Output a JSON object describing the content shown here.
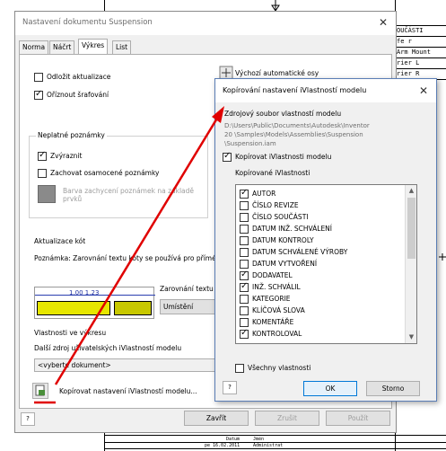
{
  "background_drawing": {
    "title_block_labels": [
      "OUČÁSTI",
      "fe r",
      "Arm Mount",
      "rier L",
      "rier R"
    ],
    "bottom_row": [
      "Datum",
      "Jmén",
      "pe 16.02.2011",
      "Administrat"
    ]
  },
  "main_dialog": {
    "title": "Nastavení dokumentu Suspension",
    "close_label": "✕",
    "tabs": [
      "Norma",
      "Náčrt",
      "Výkres",
      "List"
    ],
    "postpone_update": "Odložit aktualizace",
    "clip_hatching": "Oříznout šrafování",
    "default_axes": "Výchozí automatické osy",
    "invalid_notes": {
      "title": "Neplatné poznámky",
      "highlight": "Zvýraznit",
      "keep_orphaned": "Zachovat osamocené poznámky",
      "capture_color": "Barva zachycení poznámek na základě prvků"
    },
    "dimension_update": {
      "title": "Aktualizace kót",
      "note_text": "Poznámka: Zarovnání textu kóty se používá pro přímé",
      "preview_dim_text": "1.00 1.23",
      "text_alignment_label": "Zarovnání textu",
      "placement_button": "Umístění pohled"
    },
    "properties_in_drawing": {
      "title": "Vlastnosti ve výkresu",
      "source_label": "Další zdroj uživatelských iVlastností modelu",
      "source_value": "<vyberte dokument>"
    },
    "copy_button": "Kopírovat nastavení iVlastností modelu...",
    "help_label": "?",
    "footer": {
      "close": "Zavřít",
      "cancel": "Zrušit",
      "apply": "Použít"
    }
  },
  "copy_dialog": {
    "title": "Kopírování nastavení iVlastností modelu",
    "close_label": "✕",
    "source_label": "Zdrojový soubor vlastností modelu",
    "source_path": [
      "D:\\Users\\Public\\Documents\\Autodesk\\Inventor",
      "20    \\Samples\\Models\\Assemblies\\Suspension",
      "\\Suspension.iam"
    ],
    "copy_props": "Kopírovat iVlastnosti modelu",
    "copied_label": "Kopírované iVlastnosti",
    "properties": [
      {
        "label": "AUTOR",
        "checked": true
      },
      {
        "label": "ČÍSLO REVIZE",
        "checked": false
      },
      {
        "label": "ČÍSLO SOUČÁSTI",
        "checked": false
      },
      {
        "label": "DATUM INŽ. SCHVÁLENÍ",
        "checked": false
      },
      {
        "label": "DATUM KONTROLY",
        "checked": false
      },
      {
        "label": "DATUM SCHVÁLENÉ VÝROBY",
        "checked": false
      },
      {
        "label": "DATUM VYTVOŘENÍ",
        "checked": false
      },
      {
        "label": "DODAVATEL",
        "checked": true
      },
      {
        "label": "INŽ. SCHVÁLIL",
        "checked": true
      },
      {
        "label": "KATEGORIE",
        "checked": false
      },
      {
        "label": "KLÍČOVÁ SLOVA",
        "checked": false
      },
      {
        "label": "KOMENTÁŘE",
        "checked": false
      },
      {
        "label": "KONTROLOVAL",
        "checked": true
      }
    ],
    "all_properties": "Všechny vlastnosti",
    "ok": "OK",
    "cancel": "Storno",
    "help_label": "?"
  },
  "colors": {
    "annotation_arrow": "#e00000",
    "dialog_accent": "#0078d7",
    "yellow_preview": "#e6e600"
  }
}
